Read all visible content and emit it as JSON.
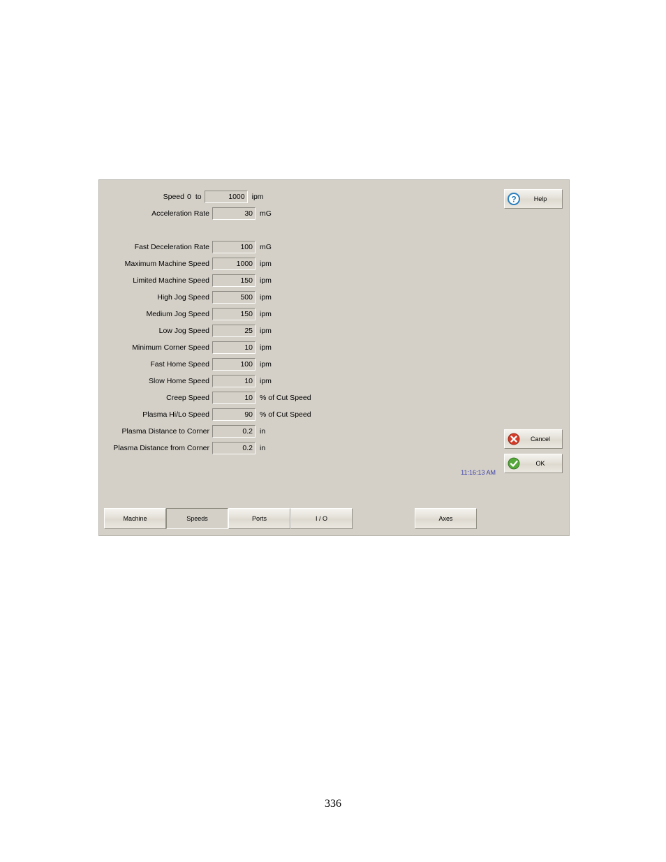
{
  "topRows": {
    "speedLabel": "Speed",
    "zero": "0",
    "to": "to",
    "speedValue": "1000",
    "speedUnit": "ipm",
    "accelLabel": "Acceleration Rate",
    "accelValue": "30",
    "accelUnit": "mG"
  },
  "rows": [
    {
      "label": "Fast Deceleration Rate",
      "value": "100",
      "unit": "mG"
    },
    {
      "label": "Maximum Machine Speed",
      "value": "1000",
      "unit": "ipm"
    },
    {
      "label": "Limited Machine Speed",
      "value": "150",
      "unit": "ipm"
    },
    {
      "label": "High Jog Speed",
      "value": "500",
      "unit": "ipm"
    },
    {
      "label": "Medium Jog Speed",
      "value": "150",
      "unit": "ipm"
    },
    {
      "label": "Low Jog Speed",
      "value": "25",
      "unit": "ipm"
    },
    {
      "label": "Minimum Corner Speed",
      "value": "10",
      "unit": "ipm"
    },
    {
      "label": "Fast Home Speed",
      "value": "100",
      "unit": "ipm"
    },
    {
      "label": "Slow Home Speed",
      "value": "10",
      "unit": "ipm"
    },
    {
      "label": "Creep Speed",
      "value": "10",
      "unit": "% of Cut Speed"
    },
    {
      "label": "Plasma Hi/Lo Speed",
      "value": "90",
      "unit": "% of Cut Speed"
    },
    {
      "label": "Plasma Distance to Corner",
      "value": "0.2",
      "unit": "in"
    },
    {
      "label": "Plasma Distance from Corner",
      "value": "0.2",
      "unit": "in"
    }
  ],
  "sideButtons": {
    "help": "Help",
    "cancel": "Cancel",
    "ok": "OK"
  },
  "timestamp": "11:16:13 AM",
  "tabs": {
    "machine": "Machine",
    "speeds": "Speeds",
    "ports": "Ports",
    "io": "I / O",
    "axes": "Axes"
  },
  "pageNumber": "336"
}
